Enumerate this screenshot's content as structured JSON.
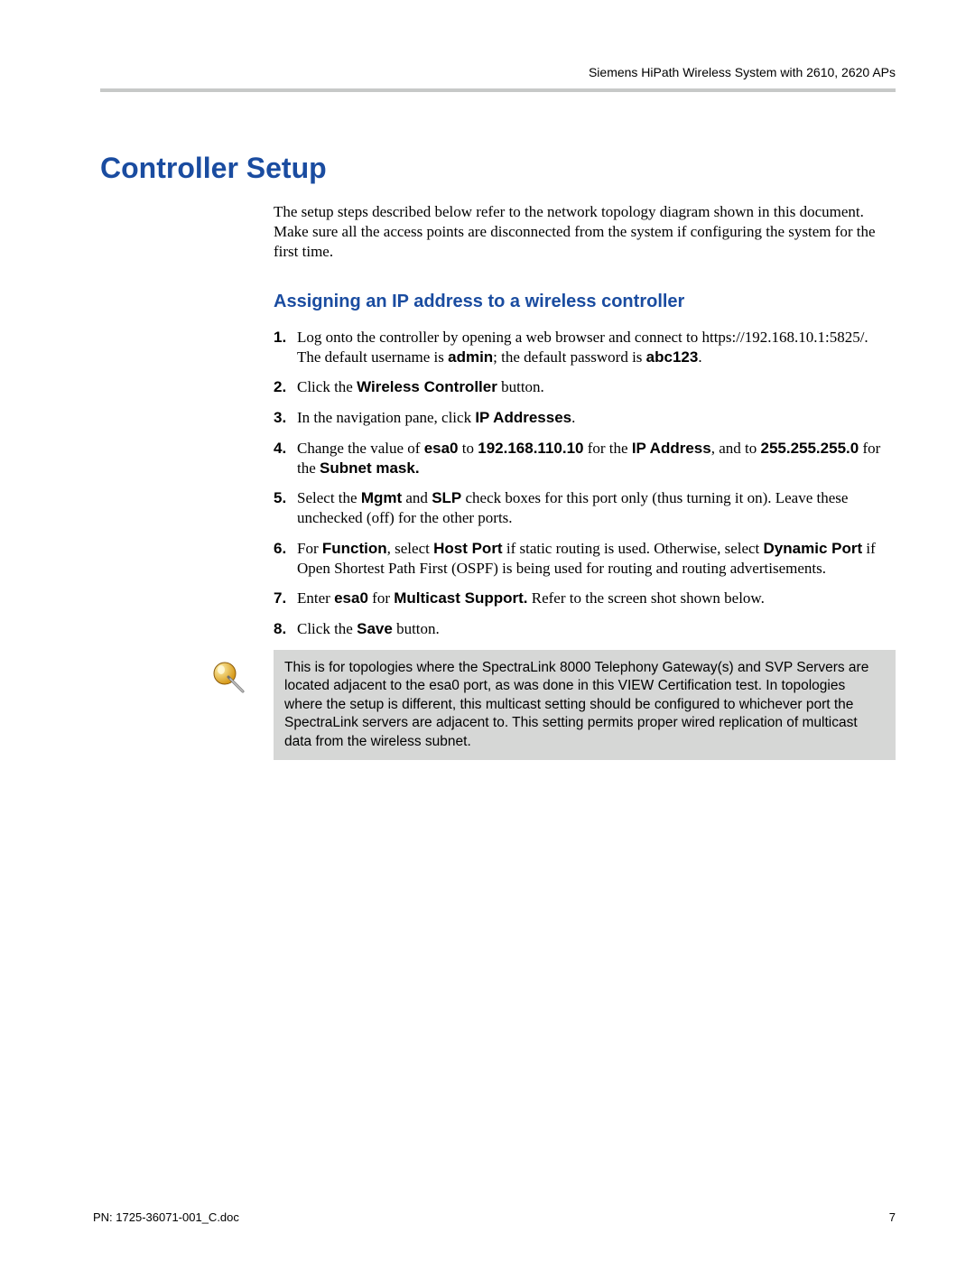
{
  "header": {
    "product": "Siemens HiPath Wireless System with 2610, 2620 APs"
  },
  "title": "Controller Setup",
  "intro": "The setup steps described below refer to the network topology diagram shown in this document. Make sure all the access points are disconnected from the system if configuring the system for the first time.",
  "section": {
    "heading": "Assigning an IP address to a wireless controller",
    "steps": [
      {
        "a": "Log onto the controller by opening a web browser and connect to https://192.168.10.1:5825/. The default username is ",
        "b": "admin",
        "c": "; the default password is ",
        "d": "abc123",
        "e": "."
      },
      {
        "a": "Click the ",
        "b": "Wireless Controller",
        "c": " button."
      },
      {
        "a": "In the navigation pane, click ",
        "b": "IP Addresses",
        "c": "."
      },
      {
        "a": "Change the value of ",
        "b": "esa0",
        "c": " to ",
        "d": "192.168.110.10",
        "e": " for the ",
        "f": "IP Address",
        "g": ", and to ",
        "h": "255.255.255.0",
        "i": " for the ",
        "j": "Subnet mask."
      },
      {
        "a": "Select the ",
        "b": "Mgmt",
        "c": " and ",
        "d": "SLP",
        "e": " check boxes for this port only (thus turning it on). Leave these unchecked (off) for the other ports."
      },
      {
        "a": "For ",
        "b": "Function",
        "c": ", select ",
        "d": "Host Port",
        "e": " if static routing is used. Otherwise, select ",
        "f": "Dynamic Port",
        "g": " if Open Shortest Path First (OSPF) is being used for routing and routing advertisements."
      },
      {
        "a": "Enter ",
        "b": "esa0",
        "c": " for ",
        "d": "Multicast Support.",
        "e": " Refer to the screen shot shown below."
      },
      {
        "a": "Click the ",
        "b": "Save",
        "c": " button."
      }
    ]
  },
  "note": "This is for topologies where the SpectraLink 8000 Telephony Gateway(s) and SVP Servers are located adjacent to the esa0 port, as was done in this VIEW Certification test. In topologies where the setup is different, this multicast setting should be configured to whichever port the SpectraLink servers are adjacent to. This setting permits proper wired replication of multicast data from the wireless subnet.",
  "footer": {
    "pn": "PN: 1725-36071-001_C.doc",
    "page": "7"
  },
  "colors": {
    "heading": "#1a4ca0",
    "rule": "#c7c9c8",
    "noteBg": "#d6d7d6"
  }
}
